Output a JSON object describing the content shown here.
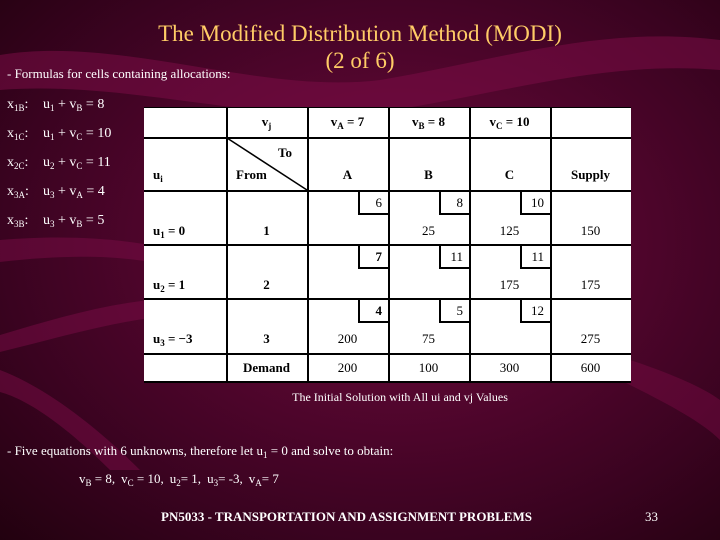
{
  "slide": {
    "title_line1": "The Modified Distribution Method (MODI)",
    "title_line2": "(2 of 6)",
    "intro": "- Formulas for cells containing allocations:",
    "formulas": [
      {
        "cell": "x",
        "cell_sub": "1B",
        "u": "u",
        "u_sub": "1",
        "v": "v",
        "v_sub": "B",
        "rhs": "8"
      },
      {
        "cell": "x",
        "cell_sub": "1C",
        "u": "u",
        "u_sub": "1",
        "v": "v",
        "v_sub": "C",
        "rhs": "10"
      },
      {
        "cell": "x",
        "cell_sub": "2C",
        "u": "u",
        "u_sub": "2",
        "v": "v",
        "v_sub": "C",
        "rhs": "11"
      },
      {
        "cell": "x",
        "cell_sub": "3A",
        "u": "u",
        "u_sub": "3",
        "v": "v",
        "v_sub": "A",
        "rhs": "4"
      },
      {
        "cell": "x",
        "cell_sub": "3B",
        "u": "u",
        "u_sub": "3",
        "v": "v",
        "v_sub": "B",
        "rhs": "5"
      }
    ],
    "caption": "The Initial Solution with All ui and vj Values",
    "conclusion": {
      "prefix": "- Five equations with 6 unknowns, therefore let u",
      "sub": "1",
      "suffix": " = 0 and solve to obtain:"
    },
    "solution": [
      {
        "var": "v",
        "sub": "B",
        "val": " = 8,"
      },
      {
        "var": "v",
        "sub": "C",
        "val": " = 10,"
      },
      {
        "var": "u",
        "sub": "2",
        "val": "= 1,"
      },
      {
        "var": "u",
        "sub": "3",
        "val": "= -3,"
      },
      {
        "var": "v",
        "sub": "A",
        "val": "= 7"
      }
    ],
    "footer": "PN5033 - TRANSPORTATION AND ASSIGNMENT PROBLEMS",
    "page_number": "33",
    "colors": {
      "title": "#ffcc66",
      "text": "#ffffff",
      "background": "#55062f"
    }
  },
  "table": {
    "vj_label": "v",
    "vj_sub": "j",
    "ui_label": "u",
    "ui_sub": "i",
    "to_label": "To",
    "from_label": "From",
    "v_headers": [
      {
        "v": "v",
        "sub": "A",
        "val": " = 7"
      },
      {
        "v": "v",
        "sub": "B",
        "val": " = 8"
      },
      {
        "v": "v",
        "sub": "C",
        "val": " = 10"
      }
    ],
    "columns": [
      "A",
      "B",
      "C",
      "Supply"
    ],
    "rows": [
      {
        "u": "u",
        "u_sub": "1",
        "u_val": " = 0",
        "from": "1",
        "costs": [
          "6",
          "8",
          "10"
        ],
        "alloc": [
          "",
          "25",
          "125"
        ],
        "supply": "150"
      },
      {
        "u": "u",
        "u_sub": "2",
        "u_val": " = 1",
        "from": "2",
        "costs": [
          "7",
          "11",
          "11"
        ],
        "alloc": [
          "",
          "",
          "175"
        ],
        "supply": "175"
      },
      {
        "u": "u",
        "u_sub": "3",
        "u_val": " = −3",
        "from": "3",
        "costs": [
          "4",
          "5",
          "12"
        ],
        "alloc": [
          "200",
          "75",
          ""
        ],
        "supply": "275"
      }
    ],
    "demand_label": "Demand",
    "demand": [
      "200",
      "100",
      "300"
    ],
    "total": "600"
  }
}
